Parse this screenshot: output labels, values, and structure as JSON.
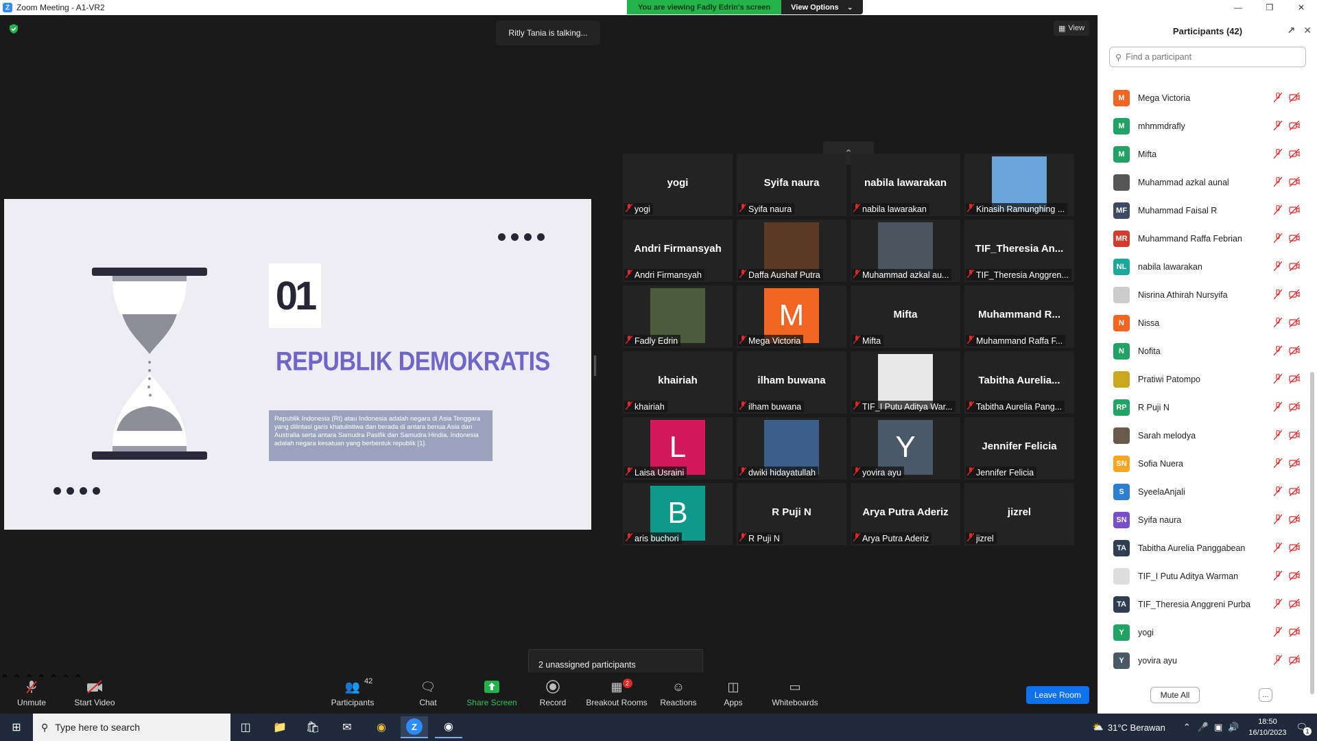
{
  "window": {
    "title": "Zoom Meeting - A1-VR2"
  },
  "banner": {
    "viewing": "You are viewing Fadly Edrin's screen",
    "view_options": "View Options"
  },
  "talking": "Ritly Tania is talking...",
  "view_label": "View",
  "slide": {
    "number": "01",
    "headline": "REPUBLIK DEMOKRATIS",
    "paragraph": "Republik Indonesia (RI) atau Indonesia adalah negara di Asia Tenggara yang dilintasi garis khatulistiwa dan berada di antara benua Asia dan Australia serta antara Samudra Pasifik dan Samudra Hindia. Indonesia adalah negara kesatuan yang berbentuk republik [1]."
  },
  "gallery": [
    {
      "big": "yogi",
      "label": "yogi"
    },
    {
      "big": "Syifa naura",
      "label": "Syifa naura"
    },
    {
      "big": "nabila lawarakan",
      "label": "nabila lawarakan"
    },
    {
      "big": "",
      "label": "Kinasih Ramunghing ...",
      "photo": "#6aa6d8"
    },
    {
      "big": "Andri Firmansyah",
      "label": "Andri Firmansyah"
    },
    {
      "big": "",
      "label": "Daffa Aushaf Putra",
      "photo": "#5a3a22"
    },
    {
      "big": "",
      "label": "Muhammad azkal au...",
      "photo": "#4a5560"
    },
    {
      "big": "TIF_Theresia  An...",
      "label": "TIF_Theresia Anggren..."
    },
    {
      "big": "",
      "label": "Fadly Edrin",
      "photo": "#4b5a3a"
    },
    {
      "big": "",
      "label": "Mega Victoria",
      "letter": "M",
      "color": "#f26522"
    },
    {
      "big": "Mifta",
      "label": "Mifta"
    },
    {
      "big": "Muhammand  R...",
      "label": "Muhammand Raffa F..."
    },
    {
      "big": "khairiah",
      "label": "khairiah"
    },
    {
      "big": "ilham buwana",
      "label": "ilham buwana"
    },
    {
      "big": "",
      "label": "TIF_I Putu Aditya War...",
      "photo": "#e8e8e8"
    },
    {
      "big": "Tabitha  Aurelia...",
      "label": "Tabitha Aurelia Pang..."
    },
    {
      "big": "",
      "label": "Laisa Usraini",
      "letter": "L",
      "color": "#d3195a"
    },
    {
      "big": "",
      "label": "dwiki hidayatullah",
      "photo": "#3b5f8a"
    },
    {
      "big": "",
      "label": "yovira ayu",
      "letter": "Y",
      "color": "#4a5868"
    },
    {
      "big": "Jennifer Felicia",
      "label": "Jennifer Felicia"
    },
    {
      "big": "",
      "label": "aris buchori",
      "letter": "B",
      "color": "#0e9a8a"
    },
    {
      "big": "R Puji N",
      "label": "R Puji N"
    },
    {
      "big": "Arya Putra Aderiz",
      "label": "Arya Putra Aderiz"
    },
    {
      "big": "jizrel",
      "label": "jizrel"
    }
  ],
  "unassigned": "2 unassigned participants",
  "toolbar": {
    "unmute": "Unmute",
    "start_video": "Start Video",
    "participants": "Participants",
    "participants_count": "42",
    "chat": "Chat",
    "share_screen": "Share Screen",
    "record": "Record",
    "breakout": "Breakout Rooms",
    "breakout_badge": "2",
    "reactions": "Reactions",
    "apps": "Apps",
    "whiteboards": "Whiteboards",
    "leave": "Leave Room"
  },
  "panel": {
    "title": "Participants (42)",
    "search_placeholder": "Find a participant",
    "mute_all": "Mute All",
    "more": "...",
    "participants": [
      {
        "initials": "M",
        "name": "Mega Victoria",
        "color": "#f26522"
      },
      {
        "initials": "M",
        "name": "mhmmdrafly",
        "color": "#21a366"
      },
      {
        "initials": "M",
        "name": "Mifta",
        "color": "#21a366"
      },
      {
        "initials": "",
        "name": "Muhammad azkal aunal",
        "color": "#555555"
      },
      {
        "initials": "MF",
        "name": "Muhammad Faisal R",
        "color": "#3d4a66"
      },
      {
        "initials": "MR",
        "name": "Muhammand Raffa Febrian",
        "color": "#d33b2c"
      },
      {
        "initials": "NL",
        "name": "nabila lawarakan",
        "color": "#1aa89a"
      },
      {
        "initials": "",
        "name": "Nisrina Athirah Nursyifa",
        "color": "#cccccc"
      },
      {
        "initials": "N",
        "name": "Nissa",
        "color": "#f26522"
      },
      {
        "initials": "N",
        "name": "Nofita",
        "color": "#21a366"
      },
      {
        "initials": "",
        "name": "Pratiwi Patompo",
        "color": "#c8a820"
      },
      {
        "initials": "RP",
        "name": "R Puji N",
        "color": "#21a366"
      },
      {
        "initials": "",
        "name": "Sarah melodya",
        "color": "#6b5a4a"
      },
      {
        "initials": "SN",
        "name": "Sofia Nuera",
        "color": "#f5a623"
      },
      {
        "initials": "S",
        "name": "SyeelaAnjali",
        "color": "#2d7dd2"
      },
      {
        "initials": "SN",
        "name": "Syifa naura",
        "color": "#7b4ec9"
      },
      {
        "initials": "TA",
        "name": "Tabitha Aurelia Panggabean",
        "color": "#2f3e52"
      },
      {
        "initials": "",
        "name": "TIF_I Putu Aditya Warman",
        "color": "#dddddd"
      },
      {
        "initials": "TA",
        "name": "TIF_Theresia Anggreni Purba",
        "color": "#2f3e52"
      },
      {
        "initials": "Y",
        "name": "yogi",
        "color": "#21a366"
      },
      {
        "initials": "Y",
        "name": "yovira ayu",
        "color": "#4a5868"
      }
    ]
  },
  "taskbar": {
    "search_placeholder": "Type here to search",
    "weather": "31°C  Berawan",
    "time": "18:50",
    "date": "16/10/2023",
    "notif": "1"
  }
}
